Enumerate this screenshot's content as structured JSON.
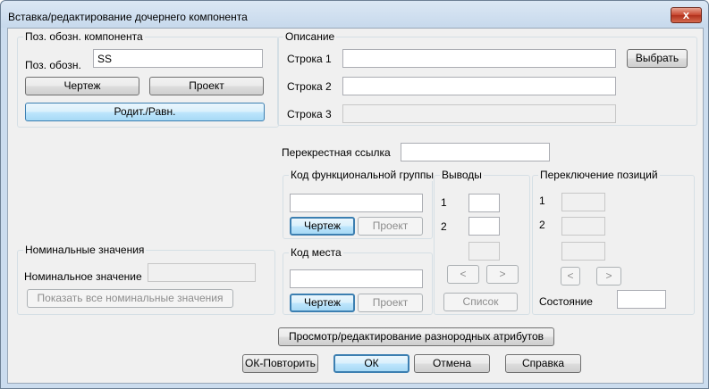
{
  "window": {
    "title": "Вставка/редактирование дочернего компонента",
    "close_glyph": "x"
  },
  "component": {
    "group_title": "Поз. обозн. компонента",
    "label": "Поз. обозн.",
    "value": "SS",
    "drawing_btn": "Чертеж",
    "project_btn": "Проект",
    "parent_btn": "Родит./Равн."
  },
  "description": {
    "group_title": "Описание",
    "line1_label": "Строка 1",
    "line1_value": "",
    "line2_label": "Строка 2",
    "line2_value": "",
    "line3_label": "Строка 3",
    "line3_value": "",
    "select_btn": "Выбрать"
  },
  "cross_ref": {
    "label": "Перекрестная ссылка",
    "value": ""
  },
  "function_group": {
    "group_title": "Код функциональной группы",
    "value": "",
    "drawing_btn": "Чертеж",
    "project_btn": "Проект"
  },
  "location": {
    "group_title": "Код места",
    "value": "",
    "drawing_btn": "Чертеж",
    "project_btn": "Проект"
  },
  "pins": {
    "group_title": "Выводы",
    "pin1_label": "1",
    "pin1_value": "",
    "pin2_label": "2",
    "pin2_value": "",
    "pin3_value": "",
    "prev_btn": "<",
    "next_btn": ">",
    "list_btn": "Список"
  },
  "positions": {
    "group_title": "Переключение позиций",
    "pos1_label": "1",
    "pos1_value": "",
    "pos2_label": "2",
    "pos2_value": "",
    "pos3_value": "",
    "prev_btn": "<",
    "next_btn": ">",
    "state_label": "Состояние",
    "state_value": ""
  },
  "ratings": {
    "group_title": "Номинальные значения",
    "label": "Номинальное значение",
    "value": "",
    "show_all_btn": "Показать все номинальные значения"
  },
  "footer": {
    "misc_attrs_btn": "Просмотр/редактирование разнородных атрибутов",
    "ok_repeat_btn": "ОК-Повторить",
    "ok_btn": "ОК",
    "cancel_btn": "Отмена",
    "help_btn": "Справка"
  }
}
